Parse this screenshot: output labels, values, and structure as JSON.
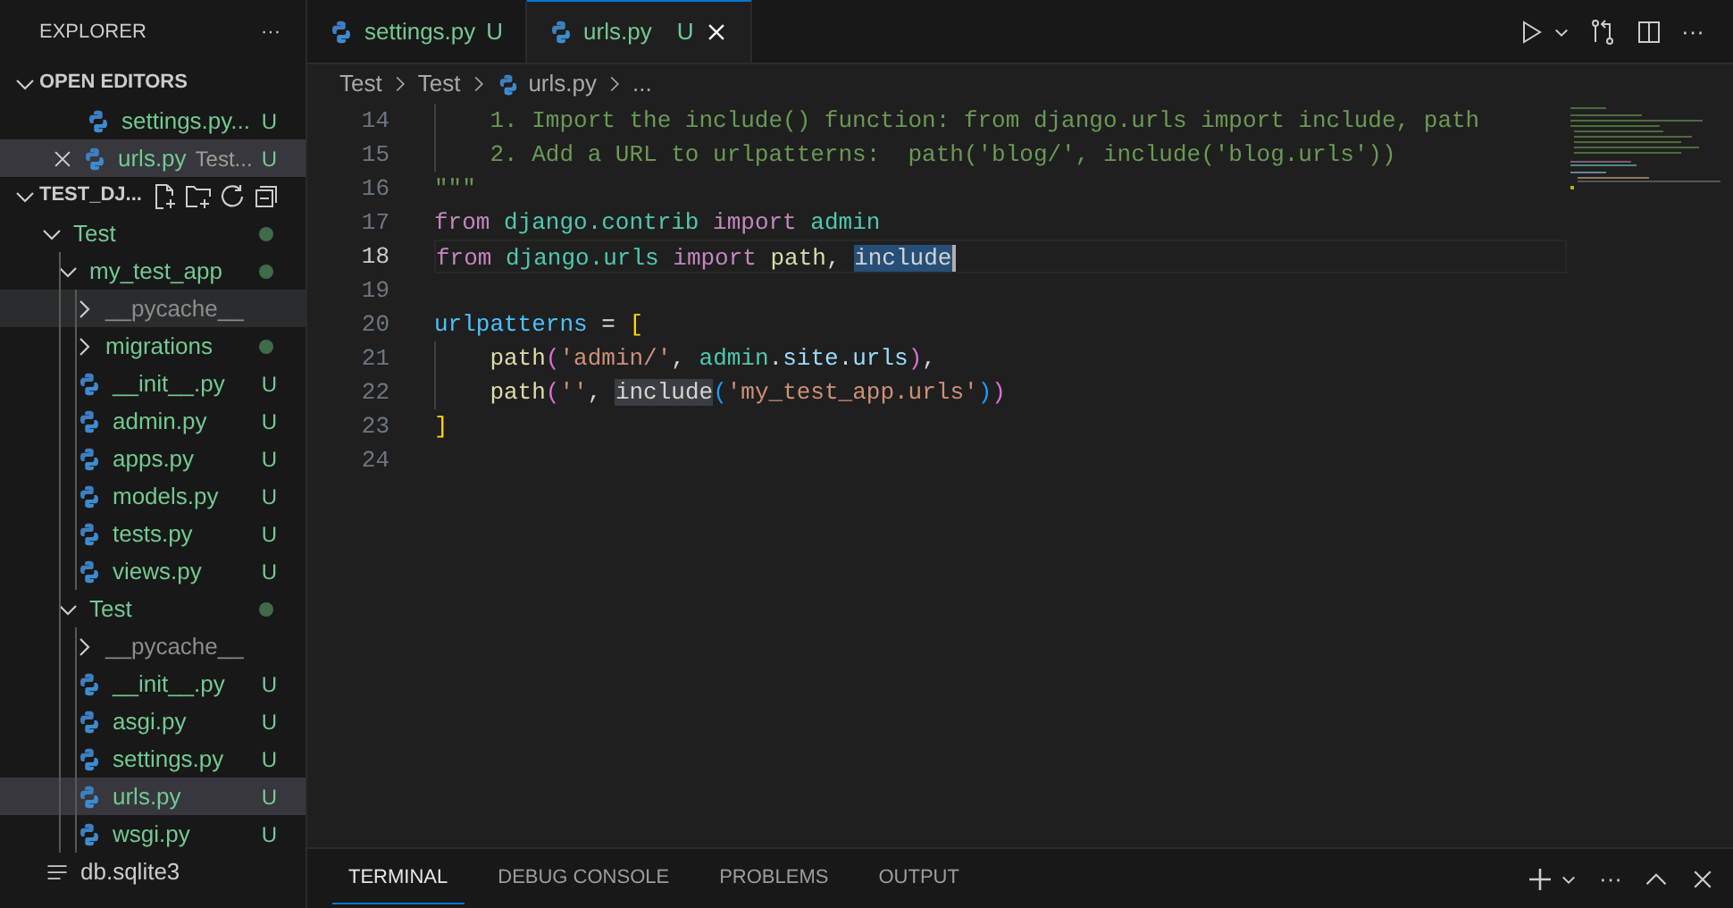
{
  "sidebar": {
    "title": "EXPLORER",
    "more": "···",
    "open_editors": {
      "label": "OPEN EDITORS",
      "expanded": true,
      "items": [
        {
          "name": "settings.py...",
          "status": "U",
          "selected": false,
          "close_visible": false
        },
        {
          "name": "urls.py",
          "description": "Test...",
          "status": "U",
          "selected": true,
          "close_visible": true
        }
      ]
    },
    "workspace": {
      "label": "TEST_DJ...",
      "expanded": true,
      "tree": [
        {
          "name": "Test",
          "kind": "folder",
          "expanded": true,
          "ignored": false,
          "has_changes": true,
          "selected": false,
          "children": [
            {
              "name": "my_test_app",
              "kind": "folder",
              "expanded": true,
              "ignored": false,
              "has_changes": true,
              "selected": false,
              "children": [
                {
                  "name": "__pycache__",
                  "kind": "folder",
                  "expanded": false,
                  "ignored": true,
                  "has_changes": false,
                  "selected": false,
                  "hovered": true
                },
                {
                  "name": "migrations",
                  "kind": "folder",
                  "expanded": false,
                  "ignored": false,
                  "has_changes": true,
                  "selected": false,
                  "hovered": false
                },
                {
                  "name": "__init__.py",
                  "kind": "file",
                  "ignored": false,
                  "status": "U",
                  "selected": false
                },
                {
                  "name": "admin.py",
                  "kind": "file",
                  "ignored": false,
                  "status": "U",
                  "selected": false
                },
                {
                  "name": "apps.py",
                  "kind": "file",
                  "ignored": false,
                  "status": "U",
                  "selected": false
                },
                {
                  "name": "models.py",
                  "kind": "file",
                  "ignored": false,
                  "status": "U",
                  "selected": false
                },
                {
                  "name": "tests.py",
                  "kind": "file",
                  "ignored": false,
                  "status": "U",
                  "selected": false
                },
                {
                  "name": "views.py",
                  "kind": "file",
                  "ignored": false,
                  "status": "U",
                  "selected": false
                }
              ]
            },
            {
              "name": "Test",
              "kind": "folder",
              "expanded": true,
              "ignored": false,
              "has_changes": true,
              "selected": false,
              "children": [
                {
                  "name": "__pycache__",
                  "kind": "folder",
                  "expanded": false,
                  "ignored": true,
                  "has_changes": false,
                  "selected": false
                },
                {
                  "name": "__init__.py",
                  "kind": "file",
                  "ignored": false,
                  "status": "U",
                  "selected": false
                },
                {
                  "name": "asgi.py",
                  "kind": "file",
                  "ignored": false,
                  "status": "U",
                  "selected": false
                },
                {
                  "name": "settings.py",
                  "kind": "file",
                  "ignored": false,
                  "status": "U",
                  "selected": false
                },
                {
                  "name": "urls.py",
                  "kind": "file",
                  "ignored": false,
                  "status": "U",
                  "selected": true
                },
                {
                  "name": "wsgi.py",
                  "kind": "file",
                  "ignored": false,
                  "status": "U",
                  "selected": false
                }
              ]
            }
          ]
        },
        {
          "name": "db.sqlite3",
          "kind": "db",
          "selected": false
        }
      ]
    }
  },
  "tabs": [
    {
      "label": "settings.py",
      "status": "U",
      "selected": false
    },
    {
      "label": "urls.py",
      "status": "U",
      "selected": true
    }
  ],
  "breadcrumb": [
    "Test",
    "Test",
    "urls.py",
    "..."
  ],
  "code": [
    {
      "number": "14",
      "current": false,
      "guide": true,
      "tokens": [
        {
          "kind": "comment",
          "text": "    1. Import the include() function: from django.urls import include, path"
        }
      ]
    },
    {
      "number": "15",
      "current": false,
      "guide": true,
      "tokens": [
        {
          "kind": "comment",
          "text": "    2. Add a URL to urlpatterns:  path('blog/', include('blog.urls'))"
        }
      ]
    },
    {
      "number": "16",
      "current": false,
      "guide": false,
      "tokens": [
        {
          "kind": "comment",
          "text": "\"\"\""
        }
      ]
    },
    {
      "number": "17",
      "current": false,
      "guide": false,
      "tokens": [
        {
          "kind": "keyword",
          "text": "from"
        },
        {
          "kind": "module",
          "text": " django.contrib"
        },
        {
          "kind": "keyword",
          "text": " import"
        },
        {
          "kind": "module",
          "text": " admin"
        }
      ]
    },
    {
      "number": "18",
      "current": true,
      "guide": false,
      "tokens": [
        {
          "kind": "keyword",
          "text": "from"
        },
        {
          "kind": "module",
          "text": " django.urls"
        },
        {
          "kind": "keyword",
          "text": " import"
        },
        {
          "kind": "func",
          "text": " path"
        },
        {
          "kind": "plain",
          "text": ", "
        },
        {
          "kind": "selection",
          "text": "include"
        }
      ]
    },
    {
      "number": "19",
      "current": false,
      "guide": false
    },
    {
      "number": "20",
      "current": false,
      "guide": false,
      "tokens": [
        {
          "kind": "constant",
          "text": "urlpatterns"
        },
        {
          "kind": "plain",
          "text": " = "
        },
        {
          "kind": "bracket1",
          "text": "["
        }
      ]
    },
    {
      "number": "21",
      "current": false,
      "guide": true,
      "tokens": [
        {
          "kind": "func",
          "text": "    path"
        },
        {
          "kind": "bracket2",
          "text": "("
        },
        {
          "kind": "string",
          "text": "'admin/'"
        },
        {
          "kind": "plain",
          "text": ", "
        },
        {
          "kind": "module",
          "text": "admin"
        },
        {
          "kind": "plain",
          "text": "."
        },
        {
          "kind": "variable",
          "text": "site"
        },
        {
          "kind": "plain",
          "text": "."
        },
        {
          "kind": "variable",
          "text": "urls"
        },
        {
          "kind": "bracket2",
          "text": ")"
        },
        {
          "kind": "plain",
          "text": ","
        }
      ]
    },
    {
      "number": "22",
      "current": false,
      "guide": true,
      "tokens": [
        {
          "kind": "func",
          "text": "    path"
        },
        {
          "kind": "bracket2",
          "text": "("
        },
        {
          "kind": "string",
          "text": "''"
        },
        {
          "kind": "plain",
          "text": ", "
        },
        {
          "kind": "match",
          "text": "include"
        },
        {
          "kind": "bracket3",
          "text": "("
        },
        {
          "kind": "string",
          "text": "'my_test_app.urls'"
        },
        {
          "kind": "bracket3",
          "text": ")"
        },
        {
          "kind": "bracket2",
          "text": ")"
        }
      ]
    },
    {
      "number": "23",
      "current": false,
      "guide": false,
      "tokens": [
        {
          "kind": "bracket1",
          "text": "]"
        }
      ]
    },
    {
      "number": "24",
      "current": false,
      "guide": false
    }
  ],
  "panel": {
    "tabs": [
      {
        "label": "TERMINAL",
        "selected": true
      },
      {
        "label": "DEBUG CONSOLE",
        "selected": false
      },
      {
        "label": "PROBLEMS",
        "selected": false
      },
      {
        "label": "OUTPUT",
        "selected": false
      }
    ],
    "more": "···"
  }
}
